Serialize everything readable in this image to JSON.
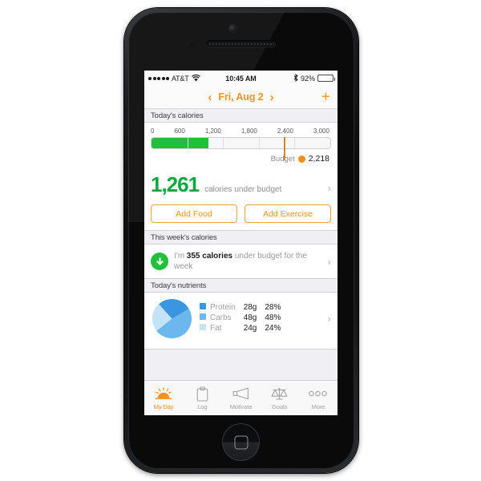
{
  "device": {
    "name": "iphone-5-black"
  },
  "status_bar": {
    "carrier": "AT&T",
    "signal_icon": "signal-dots-icon",
    "wifi_icon": "wifi-icon",
    "time": "10:45 AM",
    "bluetooth_icon": "bluetooth-icon",
    "battery_percent": "92%",
    "battery_level": 92
  },
  "nav_bar": {
    "prev_icon": "chevron-left-icon",
    "date": "Fri, Aug 2",
    "next_icon": "chevron-right-icon",
    "add_label": "+"
  },
  "sections": {
    "today_calories": {
      "header": "Today's calories",
      "scale": [
        "0",
        "600",
        "1,200",
        "1,800",
        "2,400",
        "3,000"
      ],
      "scale_max": 3000,
      "consumed": 957,
      "budget_label": "Budget",
      "budget_value": "2,218",
      "budget_number": 2218,
      "remaining": "1,261",
      "remaining_text": "calories under budget",
      "add_food_label": "Add Food",
      "add_exercise_label": "Add Exercise",
      "fill_color": "#22bf3d",
      "remaining_color": "#0aa83f",
      "budget_marker_color": "#f2901e"
    },
    "week_calories": {
      "header": "This week's calories",
      "icon": "arrow-down-circle-icon",
      "text_prefix": "I'm ",
      "text_bold": "355 calories",
      "text_suffix": " under budget for the week",
      "icon_color": "#22bf3d"
    },
    "today_nutrients": {
      "header": "Today's nutrients",
      "chart_type": "pie",
      "rows": [
        {
          "name": "Protein",
          "grams": "28g",
          "percent": "28%",
          "value": 28,
          "color": "#3b96e0"
        },
        {
          "name": "Carbs",
          "grams": "48g",
          "percent": "48%",
          "value": 48,
          "color": "#6cb8ee"
        },
        {
          "name": "Fat",
          "grams": "24g",
          "percent": "24%",
          "value": 24,
          "color": "#c5e3f8"
        }
      ]
    }
  },
  "chart_data": {
    "type": "pie",
    "title": "Today's nutrients",
    "categories": [
      "Protein",
      "Carbs",
      "Fat"
    ],
    "values": [
      28,
      48,
      24
    ],
    "value_labels": [
      "28g",
      "48g",
      "24g"
    ],
    "percent_labels": [
      "28%",
      "48%",
      "24%"
    ],
    "colors": [
      "#3b96e0",
      "#6cb8ee",
      "#c5e3f8"
    ],
    "legend": "right",
    "grid": false
  },
  "tab_bar": {
    "items": [
      {
        "label": "My Day",
        "icon": "sun-icon",
        "active": true
      },
      {
        "label": "Log",
        "icon": "clipboard-icon",
        "active": false
      },
      {
        "label": "Motivate",
        "icon": "megaphone-icon",
        "active": false
      },
      {
        "label": "Goals",
        "icon": "scales-icon",
        "active": false
      },
      {
        "label": "More",
        "icon": "ellipsis-icon",
        "active": false
      }
    ],
    "accent_color": "#f7941e"
  }
}
